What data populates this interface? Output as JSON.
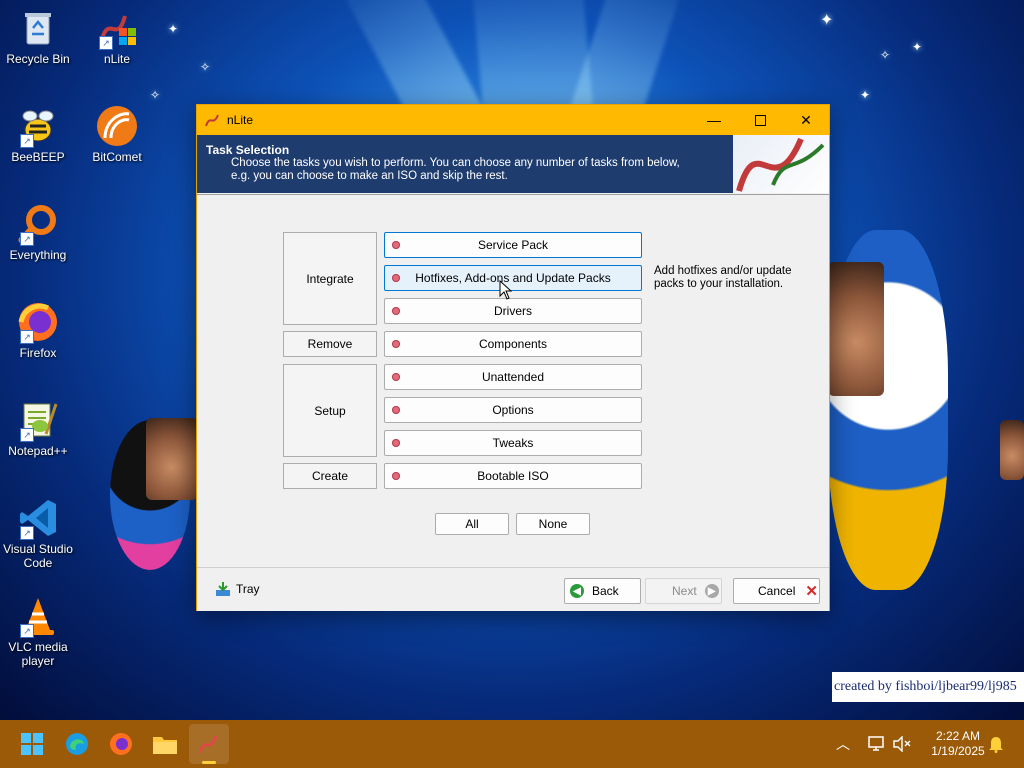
{
  "desktop": {
    "icons": [
      {
        "label": "Recycle Bin"
      },
      {
        "label": "nLite"
      },
      {
        "label": "BeeBEEP"
      },
      {
        "label": "BitComet"
      },
      {
        "label": "Everything"
      },
      {
        "label": "Firefox"
      },
      {
        "label": "Notepad++"
      },
      {
        "label": "Visual Studio Code"
      },
      {
        "label": "VLC media player"
      }
    ],
    "credit": "created by fishboi/ljbear99/lj985"
  },
  "window": {
    "title": "nLite",
    "header": {
      "title": "Task Selection",
      "description": "Choose the tasks you wish to perform. You can choose any number of tasks from below, e.g. you can choose to make an ISO and skip the rest."
    },
    "categories": {
      "integrate": "Integrate",
      "remove": "Remove",
      "setup": "Setup",
      "create": "Create"
    },
    "tasks": [
      {
        "label": "Service Pack"
      },
      {
        "label": "Hotfixes, Add-ons and Update Packs"
      },
      {
        "label": "Drivers"
      },
      {
        "label": "Components"
      },
      {
        "label": "Unattended"
      },
      {
        "label": "Options"
      },
      {
        "label": "Tweaks"
      },
      {
        "label": "Bootable ISO"
      }
    ],
    "task_description": "Add hotfixes and/or update packs to your installation.",
    "select_all": "All",
    "select_none": "None",
    "footer": {
      "tray": "Tray",
      "back": "Back",
      "next": "Next",
      "cancel": "Cancel"
    }
  },
  "taskbar": {
    "time": "2:22 AM",
    "date": "1/19/2025"
  },
  "colors": {
    "title_bar": "#ffb900",
    "header_bg": "#1f3c6f",
    "taskbar": "#9a5a08",
    "selected_border": "#0078d7"
  }
}
